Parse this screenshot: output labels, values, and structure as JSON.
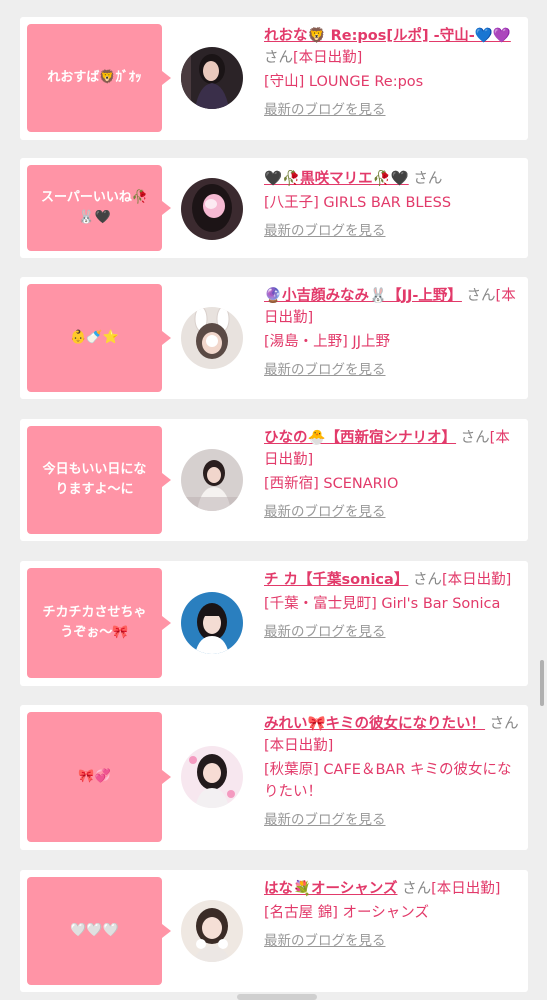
{
  "entries": [
    {
      "bubble": "れおすば🦁ｶﾞｵｯ",
      "name": "れおな🦁 Re:pos[ルポ] -守山-💙💜",
      "suffix": "さん",
      "status": "[本日出勤]",
      "shop": "[守山] LOUNGE Re:pos",
      "blog_link": "最新のブログを見る",
      "avatar": "dark-dress-portrait"
    },
    {
      "bubble": "スーパーいいね🥀🐰🖤",
      "name": "🖤🥀黒咲マリエ🥀🖤",
      "suffix": "さん",
      "status": "",
      "shop": "[八王子] GIRLS BAR BLESS",
      "blog_link": "最新のブログを見る",
      "avatar": "blurred-selfie"
    },
    {
      "bubble": "👶🍼⭐",
      "name": "🔮小吉顔みなみ🐰【JJ-上野】",
      "suffix": "さん",
      "status": "[本日出勤]",
      "shop": "[湯島・上野] JJ上野",
      "blog_link": "最新のブログを見る",
      "avatar": "bunny-ears-selfie"
    },
    {
      "bubble": "今日もいい日になりますよ〜に",
      "name": "ひなの🐣【西新宿シナリオ】",
      "suffix": "さん",
      "status": "[本日出勤]",
      "shop": "[西新宿] SCENARIO",
      "blog_link": "最新のブログを見る",
      "avatar": "white-dress-portrait"
    },
    {
      "bubble": "チカチカさせちゃうぞぉ〜🎀",
      "name": "チ カ【千葉sonica】",
      "suffix": "さん",
      "status": "[本日出勤]",
      "shop": "[千葉・富士見町] Girl's Bar Sonica",
      "blog_link": "最新のブログを見る",
      "avatar": "blue-background-portrait"
    },
    {
      "bubble": "🎀💞",
      "name": "みれい🎀キミの彼女になりたい！",
      "suffix": "さん",
      "status": "[本日出勤]",
      "shop": "[秋葉原] CAFE＆BAR キミの彼女になりたい！",
      "blog_link": "最新のブログを見る",
      "avatar": "pink-heart-portrait"
    },
    {
      "bubble": "🤍🤍🤍",
      "name": "はな💐オーシャンズ",
      "suffix": "さん",
      "status": "[本日出勤]",
      "shop": "[名古屋 錦] オーシャンズ",
      "blog_link": "最新のブログを見る",
      "avatar": "flower-crown-portrait"
    }
  ],
  "colors": {
    "accent": "#e23a6a",
    "bubble": "#ff94a6",
    "muted": "#888888",
    "background": "#eeeeee"
  }
}
